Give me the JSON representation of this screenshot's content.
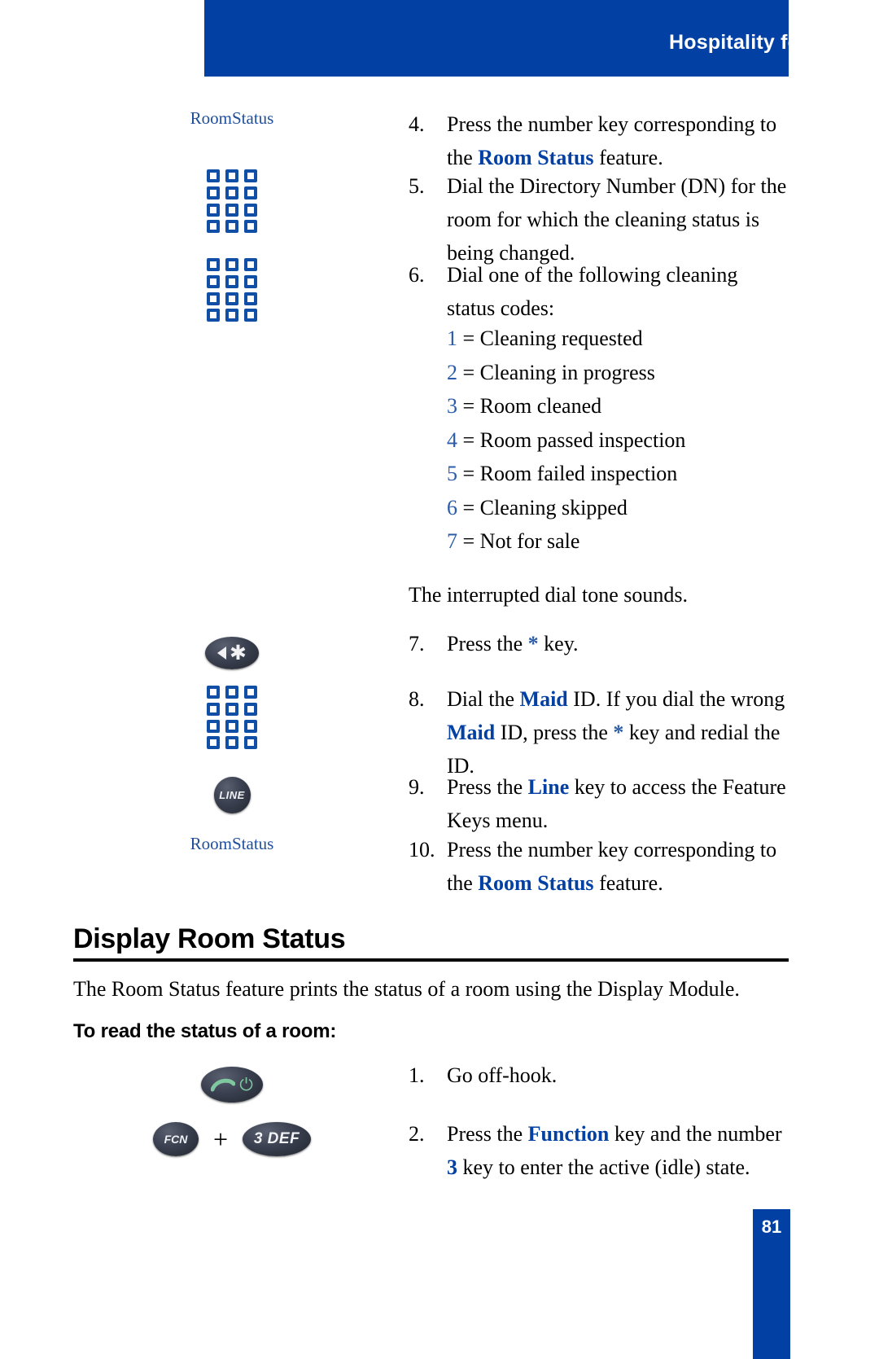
{
  "header": {
    "title": "Hospitality features",
    "band_color": "#0340a3"
  },
  "gutter_labels": {
    "room_status_top": "RoomStatus",
    "room_status_bottom": "RoomStatus"
  },
  "icons": {
    "keypad": "keypad-icon",
    "star_key": "star-key-icon",
    "line_key_label": "LINE",
    "offhook_key": "offhook-key-icon",
    "fcn_key_label": "FCN",
    "three_def_key_label": "3 DEF",
    "plus": "+"
  },
  "steps_continued": [
    {
      "num": "4.",
      "parts": [
        {
          "t": "Press the number key corresponding to the ",
          "style": "plain"
        },
        {
          "t": "Room Status",
          "style": "blue-bold"
        },
        {
          "t": " feature.",
          "style": "plain"
        }
      ]
    },
    {
      "num": "5.",
      "parts": [
        {
          "t": "Dial the Directory Number (DN) for the room for which the cleaning status is being changed.",
          "style": "plain"
        }
      ]
    },
    {
      "num": "6.",
      "parts": [
        {
          "t": "Dial one of the following cleaning status codes:",
          "style": "plain"
        }
      ]
    }
  ],
  "cleaning_codes": [
    {
      "key": "1",
      "equals": " = ",
      "label": "Cleaning requested"
    },
    {
      "key": "2",
      "equals": " = ",
      "label": "Cleaning in progress"
    },
    {
      "key": "3",
      "equals": " = ",
      "label": "Room cleaned"
    },
    {
      "key": "4",
      "equals": " = ",
      "label": "Room passed inspection"
    },
    {
      "key": "5",
      "equals": " = ",
      "label": "Room failed inspection"
    },
    {
      "key": "6",
      "equals": " = ",
      "label": "Cleaning skipped"
    },
    {
      "key": "7",
      "equals": " = ",
      "label": "Not for sale"
    }
  ],
  "dial_tone_note": "The interrupted dial tone sounds.",
  "steps_after_note": [
    {
      "num": "7.",
      "parts": [
        {
          "t": "Press the ",
          "style": "plain"
        },
        {
          "t": "*",
          "style": "blue-star"
        },
        {
          "t": " key.",
          "style": "plain"
        }
      ]
    },
    {
      "num": "8.",
      "parts": [
        {
          "t": "Dial the ",
          "style": "plain"
        },
        {
          "t": "Maid",
          "style": "blue-bold"
        },
        {
          "t": " ID. If you dial the wrong ",
          "style": "plain"
        },
        {
          "t": "Maid",
          "style": "blue-bold"
        },
        {
          "t": " ID, press the ",
          "style": "plain"
        },
        {
          "t": "*",
          "style": "blue-star"
        },
        {
          "t": " key and redial the ID.",
          "style": "plain"
        }
      ]
    },
    {
      "num": "9.",
      "parts": [
        {
          "t": "Press the ",
          "style": "plain"
        },
        {
          "t": "Line",
          "style": "blue-bold"
        },
        {
          "t": " key to access the Feature Keys menu.",
          "style": "plain"
        }
      ]
    },
    {
      "num": "10.",
      "parts": [
        {
          "t": "Press the number key corresponding to the ",
          "style": "plain"
        },
        {
          "t": "Room Status",
          "style": "blue-bold"
        },
        {
          "t": " feature.",
          "style": "plain"
        }
      ]
    }
  ],
  "section": {
    "heading": "Display Room Status",
    "intro": "The Room Status feature prints the status of a room using the Display Module.",
    "subheading": "To read the status of a room:"
  },
  "section_steps": [
    {
      "num": "1.",
      "parts": [
        {
          "t": "Go off-hook.",
          "style": "plain"
        }
      ]
    },
    {
      "num": "2.",
      "parts": [
        {
          "t": "Press the ",
          "style": "plain"
        },
        {
          "t": "Function",
          "style": "blue-bold"
        },
        {
          "t": " key and the number ",
          "style": "plain"
        },
        {
          "t": "3",
          "style": "blue-bold"
        },
        {
          "t": " key to enter the active (idle) state.",
          "style": "plain"
        }
      ]
    }
  ],
  "footer": {
    "page_number": "81"
  }
}
